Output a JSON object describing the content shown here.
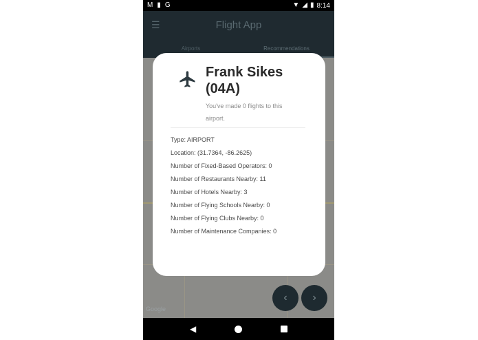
{
  "status_bar": {
    "left_icons": [
      "gmail-icon",
      "document-icon",
      "google-icon"
    ],
    "left_glyphs": [
      "M",
      "▮",
      "G"
    ],
    "right_glyphs": [
      "▼",
      "◢",
      "▮"
    ],
    "time": "8:14"
  },
  "app_bar": {
    "title": "Flight App",
    "menu_glyph": "☰"
  },
  "tabs": [
    {
      "label": "Airports"
    },
    {
      "label": "Recommendations"
    }
  ],
  "map": {
    "logo": "Google"
  },
  "fabs": {
    "prev_glyph": "‹",
    "next_glyph": "›"
  },
  "nav_bar": {
    "back_glyph": "◀"
  },
  "dialog": {
    "title": "Frank Sikes (04A)",
    "subtitle": "You've made 0 flights to this airport.",
    "details": [
      "Type: AIRPORT",
      "Location: (31.7364, -86.2625)",
      "Number of Fixed-Based Operators: 0",
      "Number of Restaurants Nearby: 11",
      "Number of Hotels Nearby: 3",
      "Number of Flying Schools Nearby: 0",
      "Number of Flying Clubs Nearby: 0",
      "Number of Maintenance Companies: 0"
    ]
  },
  "colors": {
    "app_bar": "#1f2a30",
    "dialog_bg": "#ffffff",
    "title_text": "#2a2a2a",
    "icon": "#2d3a40"
  }
}
